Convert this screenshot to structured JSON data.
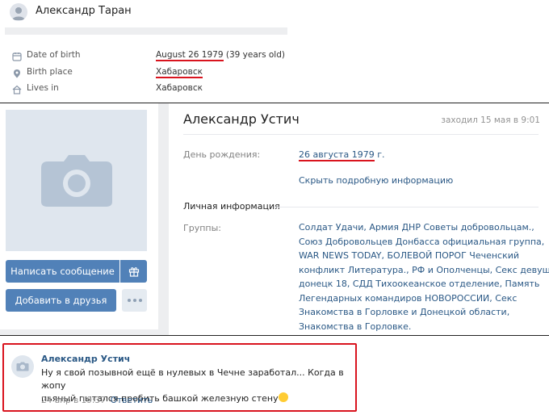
{
  "panel1": {
    "name": "Александр Таран",
    "rows": [
      {
        "label": "Date of birth",
        "value": "August 26 1979",
        "extra": " (39 years old)",
        "icon": "calendar-icon"
      },
      {
        "label": "Birth place",
        "value": "Хабаровск",
        "icon": "location-pin-icon"
      },
      {
        "label": "Lives in",
        "value": "Хабаровск",
        "icon": "home-icon"
      }
    ]
  },
  "panel2": {
    "name": "Александр Устич",
    "last_seen": "заходил 15 мая в 9:01",
    "buttons": {
      "message": "Написать сообщение",
      "add_friend": "Добавить в друзья"
    },
    "birthday_label": "День рождения:",
    "birthday_value": "26 августа 1979",
    "birthday_suffix": " г.",
    "show_more": "Скрыть подробную информацию",
    "section_title": "Личная информация",
    "groups_label": "Группы:",
    "groups_lines": [
      "Солдат Удачи, Армия ДНР Советы добровольцам.,",
      "Союз Добровольцев Донбасса официальная группа,",
      "WAR NEWS TODAY, БОЛЕВОЙ ПОРОГ Чеченский",
      "конфликт Литература., РФ и Ополченцы, Секс девушки",
      "донецк 18, СДД Тихоокеанское отделение, Память",
      "Легендарных командиров НОВОРОССИИ, Секс",
      "Знакомства в Горловке и Донецкой области,",
      "Знакомства в Горловке."
    ]
  },
  "panel3": {
    "author": "Александр Устич",
    "text_line1": "Ну я свой позывной ещё в нулевых в Чечне заработал... Когда в жопу",
    "text_line2": "пьяный пытался пробить башкой железную стену",
    "date": "24 апр в 19:37",
    "reply": "Ответить"
  },
  "colors": {
    "link": "#2a5885",
    "button": "#5181b8",
    "highlight": "#d9141e"
  }
}
